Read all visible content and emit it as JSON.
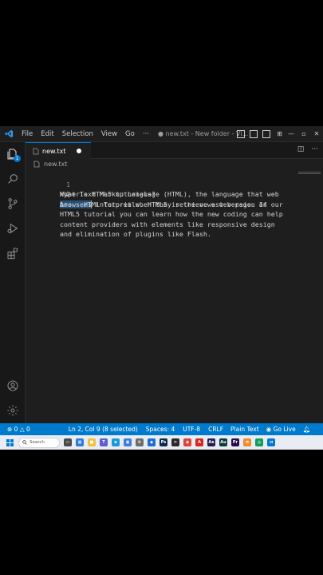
{
  "app": {
    "menu": [
      "File",
      "Edit",
      "Selection",
      "View",
      "Go"
    ],
    "more": "···",
    "window_title": "● new.txt - New folder - Vi..."
  },
  "activity": {
    "explorer_badge": "1"
  },
  "tab": {
    "label": "new.txt"
  },
  "breadcrumb": {
    "file": "new.txt"
  },
  "editor": {
    "lines": [
      {
        "number": "1",
        "text": "What is HTML5 tutorials?"
      },
      {
        "number": "2",
        "selected_text": "Ans - HT",
        "after_cursor_selected": "",
        "rest_first_row": "ML Tutorials. HTML5 is the newest version of",
        "wrapped": [
          "HyperText Markup Language (HTML), the language that web",
          "browsers interpret when they retrieve a web page. In our",
          "HTML5 tutorial you can learn how the new coding can help",
          "content providers with elements like responsive design",
          "and elimination of plugins like Flash."
        ]
      }
    ]
  },
  "status": {
    "errors": "0",
    "warnings": "0",
    "position": "Ln 2, Col 9 (8 selected)",
    "spaces": "Spaces: 4",
    "encoding": "UTF-8",
    "eol": "CRLF",
    "language": "Plain Text",
    "live": "Go Live"
  },
  "taskbar": {
    "search_label": "Search",
    "apps": [
      {
        "name": "task-view",
        "color": "#4a4a4a",
        "glyph": "▭"
      },
      {
        "name": "widgets",
        "color": "#2f7bd6",
        "glyph": "▦"
      },
      {
        "name": "file-explorer",
        "color": "#f3c03a",
        "glyph": "■"
      },
      {
        "name": "teams",
        "color": "#5b5fc7",
        "glyph": "T"
      },
      {
        "name": "edge",
        "color": "#1a9bd7",
        "glyph": "e"
      },
      {
        "name": "store",
        "color": "#3c7be0",
        "glyph": "▣"
      },
      {
        "name": "settings",
        "color": "#6d6d6d",
        "glyph": "⚙"
      },
      {
        "name": "photos",
        "color": "#1b6fd1",
        "glyph": "◆"
      },
      {
        "name": "photoshop",
        "color": "#0b2a4a",
        "glyph": "Ps"
      },
      {
        "name": "terminal",
        "color": "#2b2b2b",
        "glyph": ">"
      },
      {
        "name": "chrome",
        "color": "#db4437",
        "glyph": "◉"
      },
      {
        "name": "acrobat",
        "color": "#d5281b",
        "glyph": "A"
      },
      {
        "name": "after-effects",
        "color": "#231f4f",
        "glyph": "Ae"
      },
      {
        "name": "audition",
        "color": "#0b3b3c",
        "glyph": "Au"
      },
      {
        "name": "premiere",
        "color": "#2a0c4e",
        "glyph": "Pr"
      },
      {
        "name": "photos-app",
        "color": "#f18a2a",
        "glyph": "◓"
      },
      {
        "name": "chrome-2",
        "color": "#0f9d58",
        "glyph": "◎"
      },
      {
        "name": "vscode",
        "color": "#0078d4",
        "glyph": "⋊"
      }
    ]
  }
}
